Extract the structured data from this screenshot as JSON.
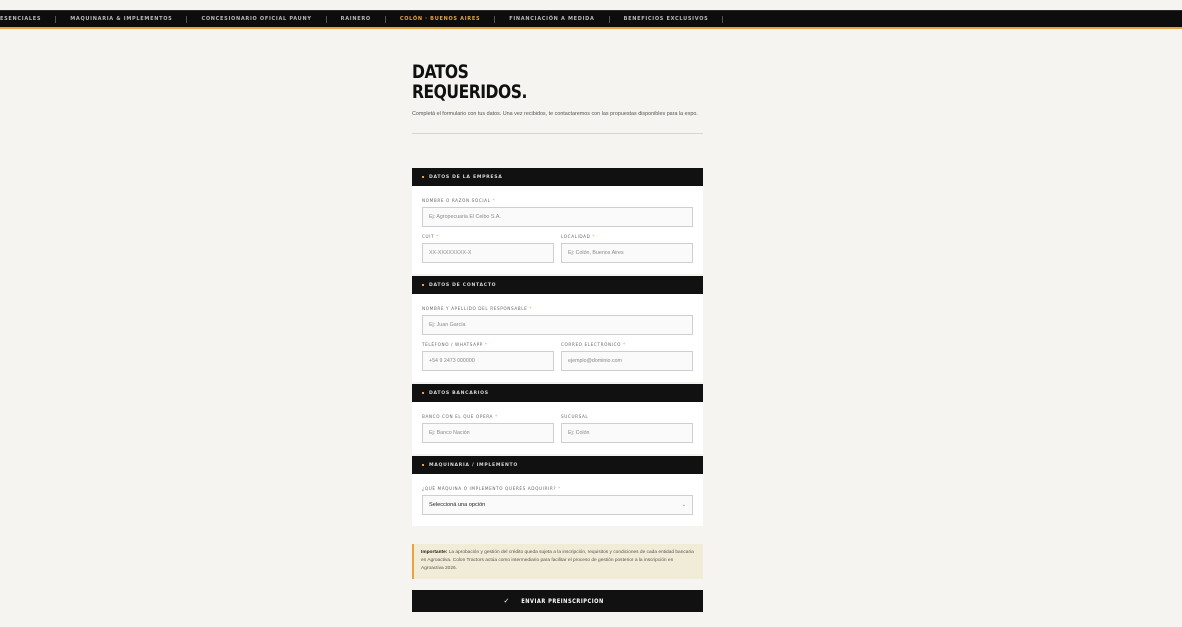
{
  "nav": {
    "items": [
      {
        "label": "Esenciales",
        "active": false
      },
      {
        "label": "Maquinaria & Implementos",
        "active": false
      },
      {
        "label": "Concesionario oficial Pauny",
        "active": false
      },
      {
        "label": "Rainero",
        "active": false
      },
      {
        "label": "Colón · Buenos Aires",
        "active": true
      },
      {
        "label": "Financiación a medida",
        "active": false
      },
      {
        "label": "Beneficios exclusivos",
        "active": false
      }
    ]
  },
  "header": {
    "title_line1": "Datos",
    "title_line2": "requeridos.",
    "intro": "Completá el formulario con tus datos. Una vez recibidos, te contactaremos con las propuestas disponibles para la expo."
  },
  "sections": {
    "empresa": {
      "title": "Datos de la empresa",
      "razon_label": "Nombre o razón social",
      "razon_placeholder": "Ej: Agropecuaria El Ceibo S.A.",
      "cuit_label": "CUIT",
      "cuit_placeholder": "XX-XXXXXXXX-X",
      "localidad_label": "Localidad",
      "localidad_placeholder": "Ej: Colón, Buenos Aires"
    },
    "contacto": {
      "title": "Datos de contacto",
      "nombre_label": "Nombre y apellido del responsable",
      "nombre_placeholder": "Ej: Juan García",
      "telefono_label": "Teléfono / WhatsApp",
      "telefono_placeholder": "+54 9 2473 000000",
      "correo_label": "Correo electrónico",
      "correo_placeholder": "ejemplo@dominio.com"
    },
    "bancarios": {
      "title": "Datos bancarios",
      "banco_label": "Banco con el que opera",
      "banco_placeholder": "Ej: Banco Nación",
      "sucursal_label": "Sucursal",
      "sucursal_placeholder": "Ej: Colón"
    },
    "maquinaria": {
      "title": "Maquinaria / Implemento",
      "pregunta_label": "¿Qué máquina o implemento querés adquirir?",
      "select_value": "Seleccioná una opción"
    }
  },
  "required_mark": "*",
  "notice": {
    "bold": "Importante:",
    "text": " La aprobación y gestión del crédito queda sujeta a la inscripción, requisitos y condiciones de cada entidad bancaria en Agroactiva. Colon Tractors actúa como intermediario para facilitar el proceso de gestión posterior a la inscripción en Agroactiva 2026."
  },
  "submit": {
    "label": "Enviar preinscripción",
    "icon": "✓"
  },
  "colors": {
    "accent": "#e8a33c",
    "dark": "#111111",
    "background": "#f5f4f0"
  }
}
